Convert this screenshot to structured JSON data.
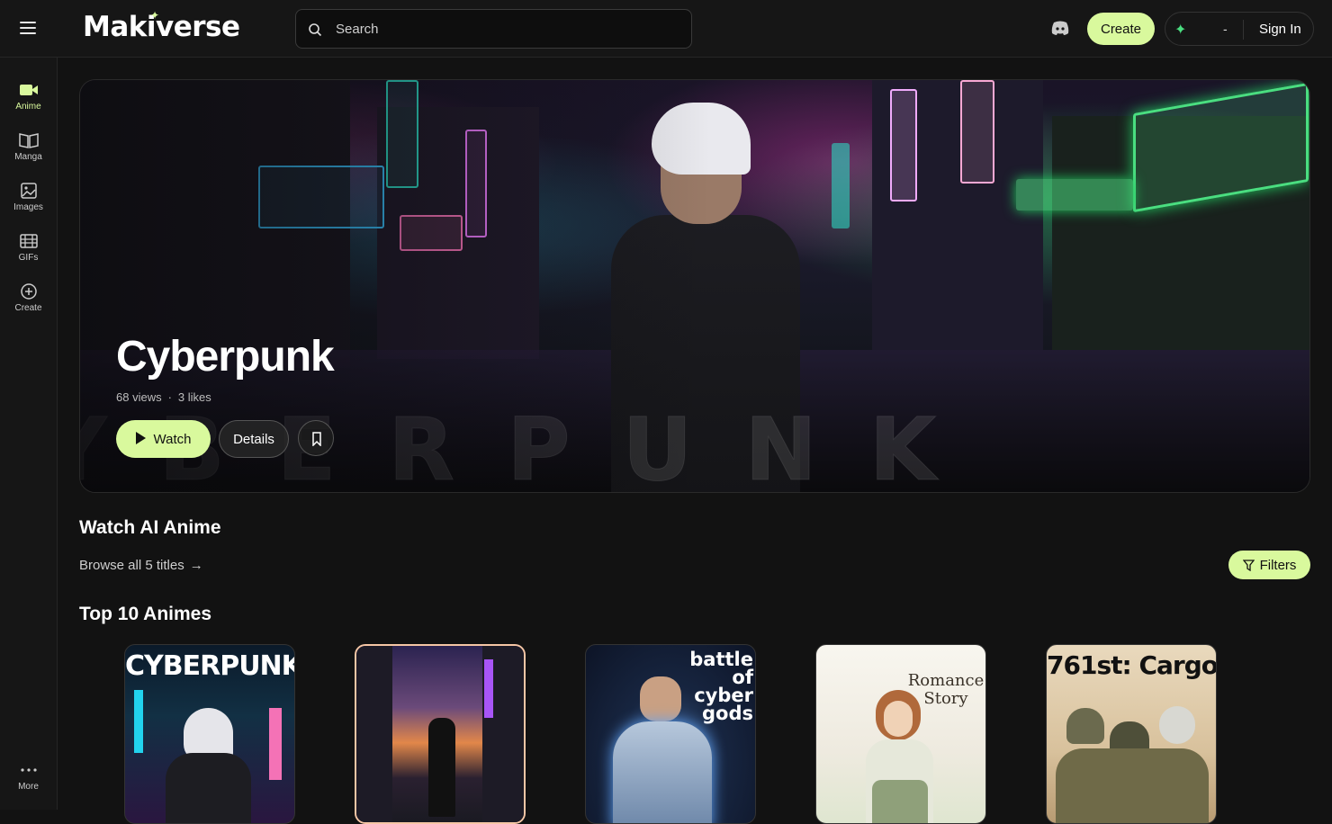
{
  "app": {
    "name": "Makiverse"
  },
  "search": {
    "placeholder": "Search"
  },
  "header": {
    "create_label": "Create",
    "credits": "-",
    "signin_label": "Sign In"
  },
  "sidebar": {
    "items": [
      {
        "label": "Anime",
        "icon": "video-camera-icon"
      },
      {
        "label": "Manga",
        "icon": "open-book-icon"
      },
      {
        "label": "Images",
        "icon": "image-icon"
      },
      {
        "label": "GIFs",
        "icon": "film-icon"
      },
      {
        "label": "Create",
        "icon": "plus-circle-icon"
      }
    ],
    "more_label": "More"
  },
  "hero": {
    "title": "Cyberpunk",
    "views": "68 views",
    "likes": "3 likes",
    "watch_label": "Watch",
    "details_label": "Details",
    "background_word": "YBERPUNK"
  },
  "section": {
    "title": "Watch AI Anime",
    "browse_label": "Browse all 5 titles",
    "filters_label": "Filters",
    "top_title": "Top 10 Animes"
  },
  "cards": [
    {
      "title": "CYBERPUNK"
    },
    {
      "title": ""
    },
    {
      "title": "battle of cyber gods"
    },
    {
      "title": "Romance Story"
    },
    {
      "title": "761st: Cargo"
    }
  ],
  "colors": {
    "accent": "#d9f99d",
    "background": "#121212",
    "surface": "#161616"
  }
}
